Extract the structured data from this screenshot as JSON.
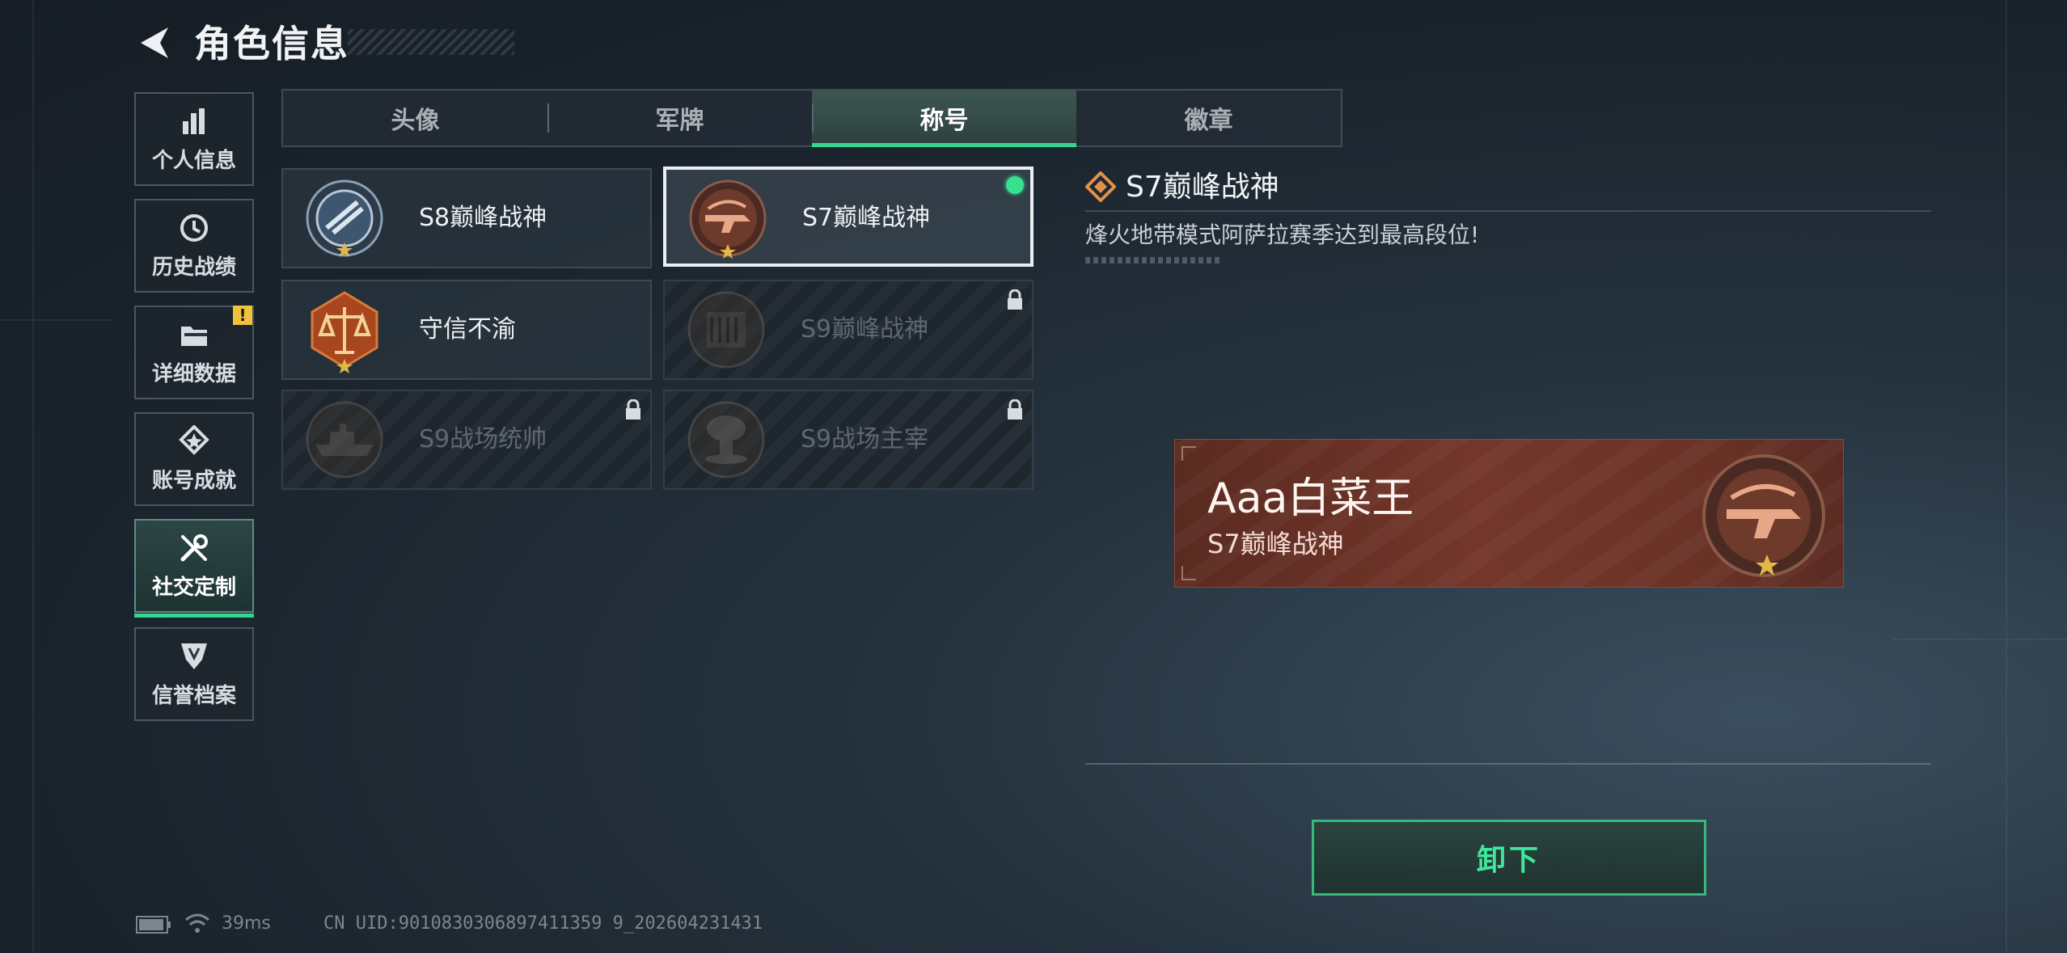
{
  "header": {
    "title": "角色信息"
  },
  "nav": {
    "items": [
      {
        "label": "个人信息",
        "icon": "bar-chart-icon"
      },
      {
        "label": "历史战绩",
        "icon": "history-icon"
      },
      {
        "label": "详细数据",
        "icon": "folder-icon",
        "badge": "!"
      },
      {
        "label": "账号成就",
        "icon": "achievement-icon"
      },
      {
        "label": "社交定制",
        "icon": "tools-icon",
        "active": true
      },
      {
        "label": "信誉档案",
        "icon": "shield-icon"
      }
    ]
  },
  "tabs": [
    {
      "label": "头像"
    },
    {
      "label": "军牌"
    },
    {
      "label": "称号",
      "active": true
    },
    {
      "label": "徽章"
    }
  ],
  "titles": [
    {
      "name": "S8巅峰战神",
      "medal": "s8-emblem-icon",
      "locked": false
    },
    {
      "name": "S7巅峰战神",
      "medal": "s7-emblem-icon",
      "locked": false,
      "selected": true,
      "equipped": true
    },
    {
      "name": "守信不渝",
      "medal": "scales-emblem-icon",
      "locked": false
    },
    {
      "name": "S9巅峰战神",
      "medal": "s9-emblem-icon",
      "locked": true
    },
    {
      "name": "S9战场统帅",
      "medal": "battleship-emblem-icon",
      "locked": true
    },
    {
      "name": "S9战场主宰",
      "medal": "mushroom-cloud-emblem-icon",
      "locked": true
    }
  ],
  "detail": {
    "title": "S7巅峰战神",
    "description": "烽火地带模式阿萨拉赛季达到最高段位!"
  },
  "preview": {
    "player_name": "Aaa白菜王",
    "title": "S7巅峰战神"
  },
  "actions": {
    "unload_label": "卸下"
  },
  "status": {
    "ping": "39ms",
    "uid": "CN UID:9010830306897411359 9_202604231431"
  },
  "colors": {
    "accent": "#35d48f",
    "warn": "#f0c23a",
    "banner": "#74362a"
  }
}
